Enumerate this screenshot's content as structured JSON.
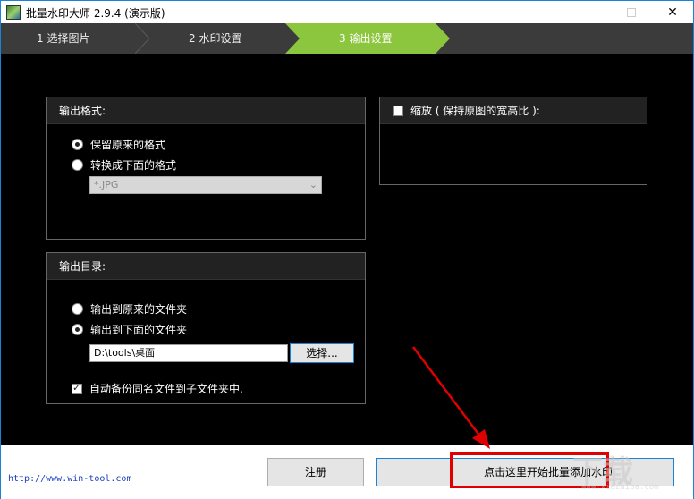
{
  "window": {
    "title": "批量水印大师 2.9.4 (演示版)"
  },
  "steps": [
    {
      "label": "1  选择图片"
    },
    {
      "label": "2  水印设置"
    },
    {
      "label": "3  输出设置"
    }
  ],
  "output_format": {
    "title": "输出格式:",
    "options": [
      {
        "label": "保留原来的格式",
        "selected": true
      },
      {
        "label": "转换成下面的格式",
        "selected": false
      }
    ],
    "format_select": "*.JPG"
  },
  "output_dir": {
    "title": "输出目录:",
    "options": [
      {
        "label": "输出到原来的文件夹",
        "selected": false
      },
      {
        "label": "输出到下面的文件夹",
        "selected": true
      }
    ],
    "path": "D:\\tools\\桌面",
    "choose_label": "选择...",
    "backup_label": "自动备份同名文件到子文件夹中.",
    "backup_checked": true
  },
  "scale": {
    "label": "缩放 ( 保持原图的宽高比 ):",
    "checked": false
  },
  "footer": {
    "url": "http://www.win-tool.com",
    "register_label": "注册",
    "start_label": "点击这里开始批量添加水印"
  },
  "watermark": {
    "text": "下载",
    "sub": "www.xiazaiba.com"
  },
  "colors": {
    "accent": "#8cc63f",
    "highlight": "#e00000",
    "link": "#1a3fbf"
  }
}
